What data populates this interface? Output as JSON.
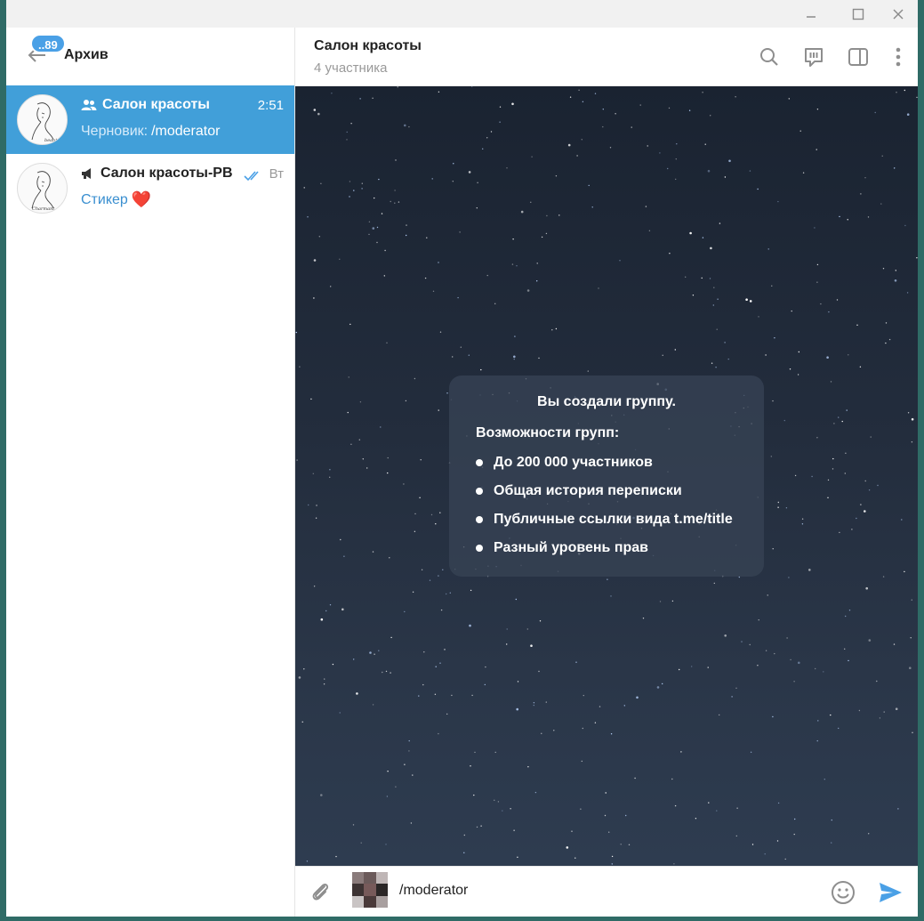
{
  "window": {
    "minimize_icon": "minimize-icon",
    "maximize_icon": "maximize-icon",
    "close_icon": "close-icon"
  },
  "sidebar": {
    "title": "Архив",
    "badge": "..89",
    "chats": [
      {
        "name": "Салон красоты",
        "type_icon": "group-icon",
        "time": "2:51",
        "preview_label": "Черновик:",
        "preview_text": "/moderator",
        "active": true
      },
      {
        "name": "Салон красоты-РВ",
        "type_icon": "channel-icon",
        "time": "Вт",
        "preview_text": "Стикер",
        "preview_emoji": "❤️",
        "read": true
      }
    ]
  },
  "main": {
    "title": "Салон красоты",
    "subtitle": "4 участника",
    "service": {
      "title": "Вы создали группу.",
      "subtitle": "Возможности групп:",
      "items": [
        "До 200 000 участников",
        "Общая история переписки",
        "Публичные ссылки вида t.me/title",
        "Разный уровень прав"
      ]
    },
    "composer": {
      "value": "/moderator"
    }
  },
  "colors": {
    "accent": "#419fd9",
    "badge": "#4aa0e6",
    "send": "#4aa0e6"
  }
}
